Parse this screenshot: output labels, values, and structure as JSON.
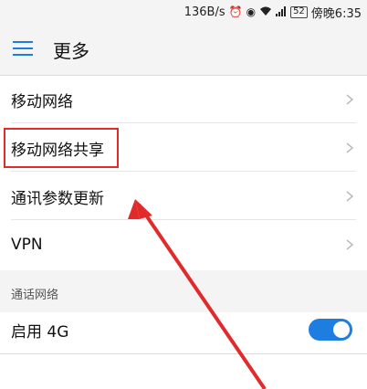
{
  "status_bar": {
    "speed": "136B/s",
    "battery": "52",
    "time": "傍晚6:35",
    "icons": [
      "alarm-icon",
      "eye-icon",
      "wifi-icon",
      "signal-icon",
      "battery-icon"
    ]
  },
  "header": {
    "menu_icon": "hamburger-menu-icon",
    "title": "更多"
  },
  "items": [
    {
      "label": "移动网络",
      "icon": "chevron-right-icon"
    },
    {
      "label": "移动网络共享",
      "icon": "chevron-right-icon"
    },
    {
      "label": "通讯参数更新",
      "icon": "chevron-right-icon"
    },
    {
      "label": "VPN",
      "icon": "chevron-right-icon"
    }
  ],
  "section": {
    "title": "通话网络",
    "toggle_label": "启用 4G",
    "toggle_on": true
  },
  "colors": {
    "accent": "#1e7de0",
    "annotation": "#e12a2a",
    "background": "#f4f4f4"
  }
}
